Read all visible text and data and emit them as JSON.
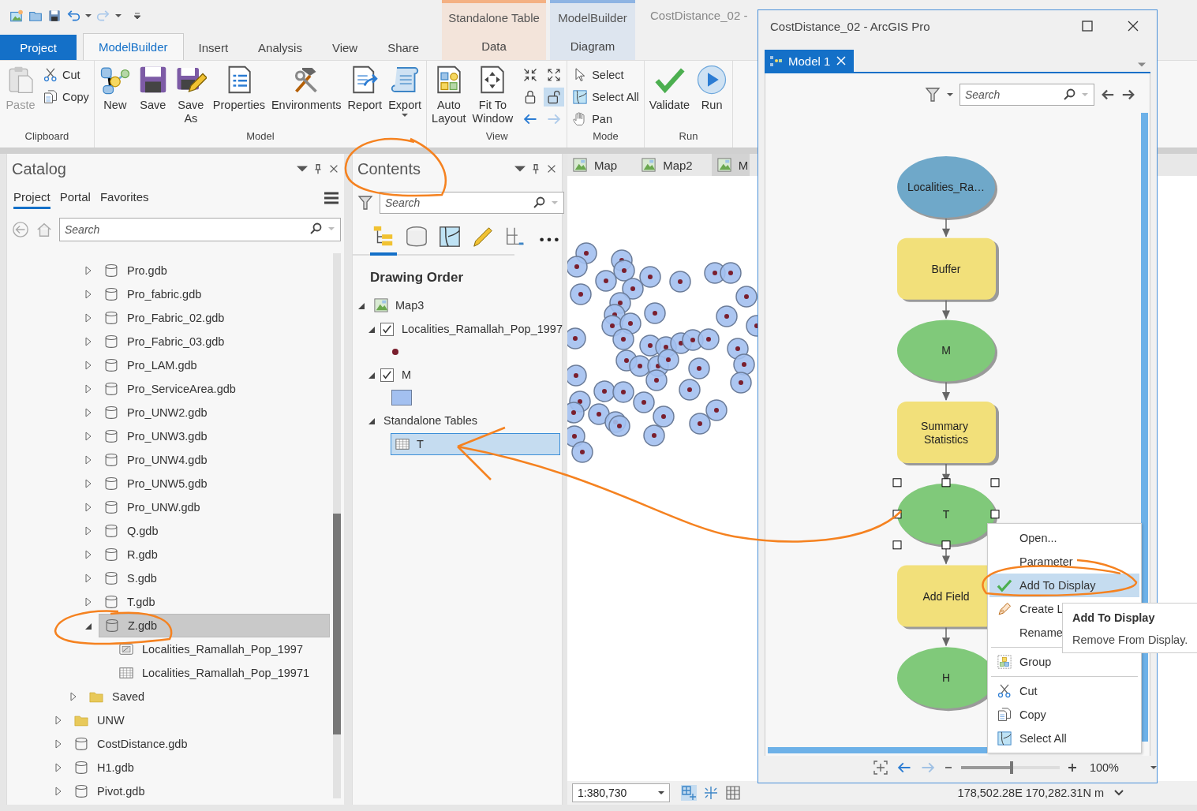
{
  "app_title": "CostDistance_02 -",
  "tabs": [
    {
      "label": "Project",
      "kind": "file",
      "selected": false
    },
    {
      "label": "ModelBuilder",
      "kind": "tab",
      "selected": true
    },
    {
      "label": "Insert",
      "kind": "tab",
      "selected": false
    },
    {
      "label": "Analysis",
      "kind": "tab",
      "selected": false
    },
    {
      "label": "View",
      "kind": "tab",
      "selected": false
    },
    {
      "label": "Share",
      "kind": "tab",
      "selected": false
    }
  ],
  "contextual_tabs": [
    {
      "header": "Standalone Table",
      "label": "Data",
      "color": "#f4b183",
      "selected": false
    },
    {
      "header": "ModelBuilder",
      "label": "Diagram",
      "color": "#8eb4e3",
      "selected": false
    }
  ],
  "ribbon": [
    {
      "label": "Clipboard",
      "buttons": [
        {
          "label": "Paste",
          "kind": "paste",
          "compact": false,
          "disabled": true
        },
        {
          "label": "Cut",
          "kind": "cut",
          "compact": true,
          "disabled": false
        },
        {
          "label": "Copy",
          "kind": "copy",
          "compact": true,
          "disabled": false
        }
      ]
    },
    {
      "label": "Model",
      "buttons": [
        {
          "label": "New",
          "kind": "new",
          "compact": false,
          "disabled": false
        },
        {
          "label": "Save",
          "kind": "save",
          "compact": false,
          "disabled": false
        },
        {
          "label": "Save\nAs",
          "kind": "saveas",
          "compact": false,
          "disabled": false
        },
        {
          "label": "Properties",
          "kind": "properties",
          "compact": false,
          "disabled": false
        },
        {
          "label": "Environments",
          "kind": "environments",
          "compact": false,
          "disabled": false
        },
        {
          "label": "Report",
          "kind": "report",
          "compact": false,
          "disabled": false
        },
        {
          "label": "Export",
          "kind": "export",
          "compact": false,
          "disabled": false,
          "dropdown": true
        }
      ]
    },
    {
      "label": "View",
      "buttons": [
        {
          "label": "Auto\nLayout",
          "kind": "autolayout",
          "compact": false,
          "disabled": false
        },
        {
          "label": "Fit To\nWindow",
          "kind": "fit",
          "compact": false,
          "disabled": false
        }
      ],
      "tools": [
        {
          "kind": "collapse",
          "on": false,
          "disabled": false
        },
        {
          "kind": "expand",
          "on": false,
          "disabled": false
        },
        {
          "kind": "lock",
          "on": false,
          "disabled": false
        },
        {
          "kind": "unlock",
          "on": true,
          "disabled": false
        },
        {
          "kind": "back",
          "on": false,
          "disabled": false
        },
        {
          "kind": "forward",
          "on": false,
          "disabled": true
        }
      ]
    },
    {
      "label": "Mode",
      "buttons": [
        {
          "label": "Select",
          "kind": "select",
          "compact": true,
          "disabled": false
        },
        {
          "label": "Select All",
          "kind": "selectall",
          "compact": true,
          "disabled": false
        },
        {
          "label": "Pan",
          "kind": "pan",
          "compact": true,
          "disabled": false
        }
      ]
    },
    {
      "label": "Run",
      "buttons": [
        {
          "label": "Validate",
          "kind": "validate",
          "compact": false,
          "disabled": false
        },
        {
          "label": "Run",
          "kind": "run",
          "compact": false,
          "disabled": false
        }
      ]
    }
  ],
  "catalog": {
    "title": "Catalog",
    "tabs": [
      {
        "label": "Project",
        "selected": true
      },
      {
        "label": "Portal",
        "selected": false
      },
      {
        "label": "Favorites",
        "selected": false
      }
    ],
    "search": {
      "placeholder": "Search"
    },
    "tree": [
      {
        "children": [
          {
            "children": [
              {
                "label": "Pro.gdb",
                "kind": "gdb",
                "expanded": false,
                "selected": false
              },
              {
                "label": "Pro_fabric.gdb",
                "kind": "gdb",
                "expanded": false,
                "selected": false
              },
              {
                "label": "Pro_Fabric_02.gdb",
                "kind": "gdb",
                "expanded": false,
                "selected": false
              },
              {
                "label": "Pro_Fabric_03.gdb",
                "kind": "gdb",
                "expanded": false,
                "selected": false
              },
              {
                "label": "Pro_LAM.gdb",
                "kind": "gdb",
                "expanded": false,
                "selected": false
              },
              {
                "label": "Pro_ServiceArea.gdb",
                "kind": "gdb",
                "expanded": false,
                "selected": false
              },
              {
                "label": "Pro_UNW2.gdb",
                "kind": "gdb",
                "expanded": false,
                "selected": false
              },
              {
                "label": "Pro_UNW3.gdb",
                "kind": "gdb",
                "expanded": false,
                "selected": false
              },
              {
                "label": "Pro_UNW4.gdb",
                "kind": "gdb",
                "expanded": false,
                "selected": false
              },
              {
                "label": "Pro_UNW5.gdb",
                "kind": "gdb",
                "expanded": false,
                "selected": false
              },
              {
                "label": "Pro_UNW.gdb",
                "kind": "gdb",
                "expanded": false,
                "selected": false
              },
              {
                "label": "Q.gdb",
                "kind": "gdb",
                "expanded": false,
                "selected": false
              },
              {
                "label": "R.gdb",
                "kind": "gdb",
                "expanded": false,
                "selected": false
              },
              {
                "label": "S.gdb",
                "kind": "gdb",
                "expanded": false,
                "selected": false
              },
              {
                "label": "T.gdb",
                "kind": "gdb",
                "expanded": false,
                "selected": false
              },
              {
                "label": "Z.gdb",
                "kind": "gdb",
                "expanded": true,
                "selected": true,
                "children": [
                  {
                    "label": "Localities_Ramallah_Pop_1997",
                    "kind": "feature",
                    "selected": false
                  },
                  {
                    "label": "Localities_Ramallah_Pop_19971",
                    "kind": "table",
                    "selected": false
                  }
                ]
              }
            ]
          },
          {
            "label": "Saved",
            "kind": "folder",
            "expanded": false,
            "selected": false
          }
        ]
      },
      {
        "label": "UNW",
        "kind": "folder",
        "expanded": false,
        "selected": false
      },
      {
        "label": "CostDistance.gdb",
        "kind": "gdb",
        "expanded": false,
        "selected": false
      },
      {
        "label": "H1.gdb",
        "kind": "gdb",
        "expanded": false,
        "selected": false
      },
      {
        "label": "Pivot.gdb",
        "kind": "gdb",
        "expanded": false,
        "selected": false
      }
    ]
  },
  "contents": {
    "title": "Contents",
    "search": {
      "placeholder": "Search"
    },
    "view_tabs": [
      {
        "kind": "drawing-order",
        "selected": true
      },
      {
        "kind": "source",
        "selected": false
      },
      {
        "kind": "selection",
        "selected": false
      },
      {
        "kind": "editing",
        "selected": false
      },
      {
        "kind": "snapping",
        "selected": false
      },
      {
        "kind": "more",
        "selected": false
      }
    ],
    "heading": "Drawing Order",
    "layers": [
      {
        "label": "Map3",
        "kind": "map",
        "expanded": true,
        "selected": false,
        "children": [
          {
            "label": "Localities_Ramallah_Pop_1997",
            "kind": "points",
            "checked": true,
            "expanded": true,
            "selected": false
          },
          {
            "label": "M",
            "kind": "polygons",
            "checked": true,
            "expanded": true,
            "selected": false
          },
          {
            "label": "Standalone Tables",
            "kind": "group",
            "expanded": true,
            "selected": false,
            "children": [
              {
                "label": "T",
                "kind": "table",
                "selected": true
              }
            ]
          }
        ]
      }
    ]
  },
  "map_view": {
    "tabs": [
      {
        "label": "Map",
        "selected": false
      },
      {
        "label": "Map2",
        "selected": false
      },
      {
        "label": "M",
        "selected": true
      }
    ],
    "scale": "1:380,730",
    "coordinates": "178,502.28E 170,282.31N m"
  },
  "model_window": {
    "title": "CostDistance_02 - ArcGIS Pro",
    "tab": {
      "label": "Model 1",
      "selected": true
    },
    "search": {
      "placeholder": "Search"
    },
    "nodes": [
      {
        "label": "Localities_Ra…",
        "kind": "data",
        "color": "#6fa8c9",
        "selected": false
      },
      {
        "label": "Buffer",
        "kind": "tool",
        "color": "#f2e07a",
        "selected": false
      },
      {
        "label": "M",
        "kind": "data",
        "color": "#80c97a",
        "selected": false
      },
      {
        "label": "Summary\nStatistics",
        "kind": "tool",
        "color": "#f2e07a",
        "selected": false
      },
      {
        "label": "T",
        "kind": "data",
        "color": "#80c97a",
        "selected": true
      },
      {
        "label": "Add Field",
        "kind": "tool",
        "color": "#f2e07a",
        "selected": false
      },
      {
        "label": "H",
        "kind": "data",
        "color": "#80c97a",
        "selected": false
      }
    ],
    "zoom": {
      "level": 0.5,
      "reading": "100%"
    }
  },
  "context_menu": {
    "groups": [
      [
        {
          "label": "Open...",
          "kind": "plain",
          "checked": false,
          "selected": false
        },
        {
          "label": "Parameter",
          "kind": "plain",
          "checked": false,
          "selected": false
        },
        {
          "label": "Add To Display",
          "kind": "plain",
          "checked": true,
          "selected": true
        },
        {
          "label": "Create L",
          "kind": "pen",
          "checked": false,
          "selected": false
        },
        {
          "label": "Rename",
          "kind": "plain",
          "checked": false,
          "selected": false
        }
      ],
      [
        {
          "label": "Group",
          "kind": "group",
          "checked": false,
          "selected": false
        }
      ],
      [
        {
          "label": "Cut",
          "kind": "cut",
          "checked": false,
          "selected": false
        },
        {
          "label": "Copy",
          "kind": "copy",
          "checked": false,
          "selected": false
        },
        {
          "label": "Select All",
          "kind": "selectall",
          "checked": false,
          "selected": false
        }
      ]
    ]
  },
  "tooltip": {
    "title": "Add To Display",
    "text": "Remove From Display."
  }
}
